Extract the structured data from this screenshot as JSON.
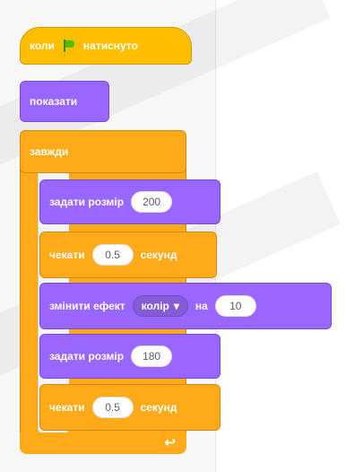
{
  "blocks": {
    "when_flag_clicked": {
      "label_before": "коли",
      "icon": "green-flag-icon",
      "label_after": "натиснуто"
    },
    "show": {
      "label": "показати"
    },
    "forever": {
      "label": "завжди"
    },
    "set_size_1": {
      "label": "задати розмір",
      "value": "200"
    },
    "wait_1": {
      "label": "чекати",
      "value": "0.5",
      "unit": "секунд"
    },
    "change_effect": {
      "label": "змінити ефект",
      "effect": "колір",
      "by": "на",
      "value": "10"
    },
    "set_size_2": {
      "label": "задати розмір",
      "value": "180"
    },
    "wait_2": {
      "label": "чекати",
      "value": "0.5",
      "unit": "секунд"
    }
  },
  "colors": {
    "events": "#ffbf00",
    "looks": "#9966ff",
    "control": "#ffab19"
  }
}
